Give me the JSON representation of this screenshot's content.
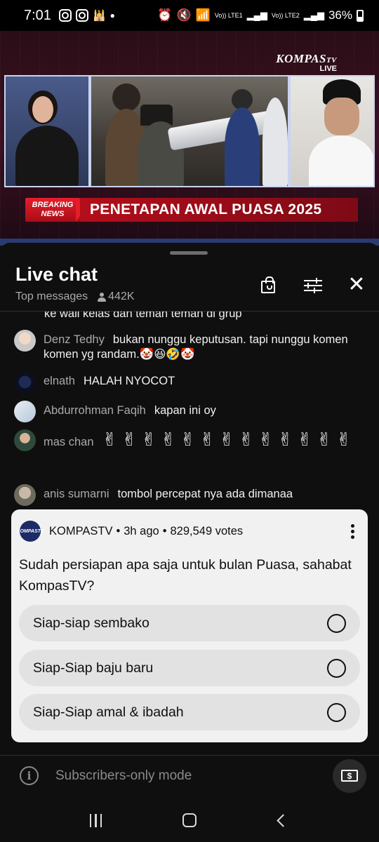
{
  "status_bar": {
    "time": "7:01",
    "battery": "36%",
    "icons": [
      "instagram-icon",
      "instagram-icon",
      "mosque-icon",
      "dot-icon",
      "alarm-icon",
      "mute-icon",
      "wifi-icon",
      "signal-lte1-icon",
      "signal-lte2-icon",
      "battery-icon"
    ],
    "lte1": "Vo)) LTE1",
    "lte2": "Vo)) LTE2"
  },
  "video": {
    "logo_name": "KOMPAS",
    "logo_suffix": "TV",
    "logo_live": "LIVE",
    "breaking_line1": "BREAKING",
    "breaking_line2": "NEWS",
    "headline": "PENETAPAN AWAL PUASA 2025"
  },
  "chat": {
    "title": "Live chat",
    "mode": "Top messages",
    "viewers": "442K",
    "cutoff_text": "ke wali kelas dan teman teman di grup",
    "messages": [
      {
        "author": "Denz Tedhy",
        "text": "bukan nunggu keputusan. tapi nunggu komen komen yg randam.🤡😆🤣🤡"
      },
      {
        "author": "elnath",
        "text": "HALAH NYOCOT"
      },
      {
        "author": "Abdurrohman Faqih",
        "text": "kapan ini oy"
      },
      {
        "author": "mas chan",
        "text": "✌✌✌✌✌✌✌✌✌✌✌✌✌"
      },
      {
        "author": "anis sumarni",
        "text": "tombol percepat nya ada dimanaa"
      }
    ]
  },
  "poll": {
    "channel": "KOMPASTV",
    "logo_text": "KOMPASTV",
    "time_ago": "3h ago",
    "votes": "829,549 votes",
    "separator": "•",
    "question": "Sudah persiapan apa saja untuk bulan Puasa, sahabat KompasTV?",
    "options": [
      "Siap-siap sembako",
      "Siap-Siap baju baru",
      "Siap-Siap amal & ibadah"
    ]
  },
  "input": {
    "placeholder": "Subscribers-only mode",
    "info_glyph": "i",
    "super_glyph": "$"
  },
  "colors": {
    "accent_red": "#e61d2a",
    "chat_bg": "#0f0f0f",
    "poll_bg": "#f1f1f1",
    "option_bg": "#e2e2e2"
  }
}
